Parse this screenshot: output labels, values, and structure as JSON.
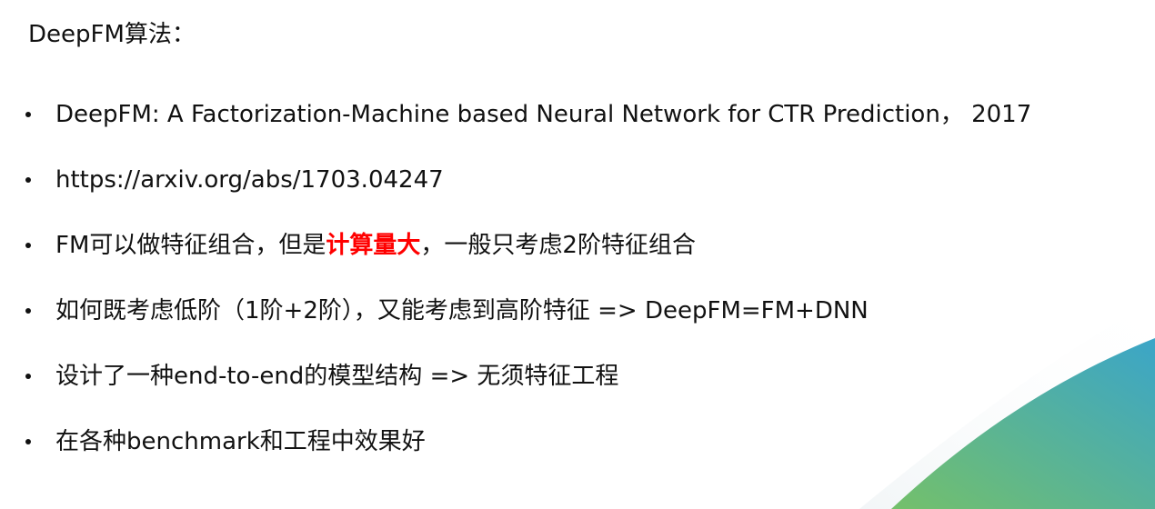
{
  "slide": {
    "title": "DeepFM算法：",
    "bullets": [
      {
        "text": "DeepFM: A Factorization-Machine based Neural Network for CTR Prediction， 2017"
      },
      {
        "text": "https://arxiv.org/abs/1703.04247"
      },
      {
        "text_before": "FM可以做特征组合，但是",
        "highlight": "计算量大",
        "text_after": "，一般只考虑2阶特征组合"
      },
      {
        "text": "如何既考虑低阶（1阶+2阶），又能考虑到高阶特征 => DeepFM=FM+DNN"
      },
      {
        "text": "设计了一种end-to-end的模型结构 => 无须特征工程"
      },
      {
        "text": "在各种benchmark和工程中效果好"
      }
    ]
  },
  "colors": {
    "highlight": "#ff0000",
    "accent_blue": "#3ba5c8",
    "accent_green": "#74c06a",
    "text": "#111111",
    "background": "#ffffff"
  }
}
